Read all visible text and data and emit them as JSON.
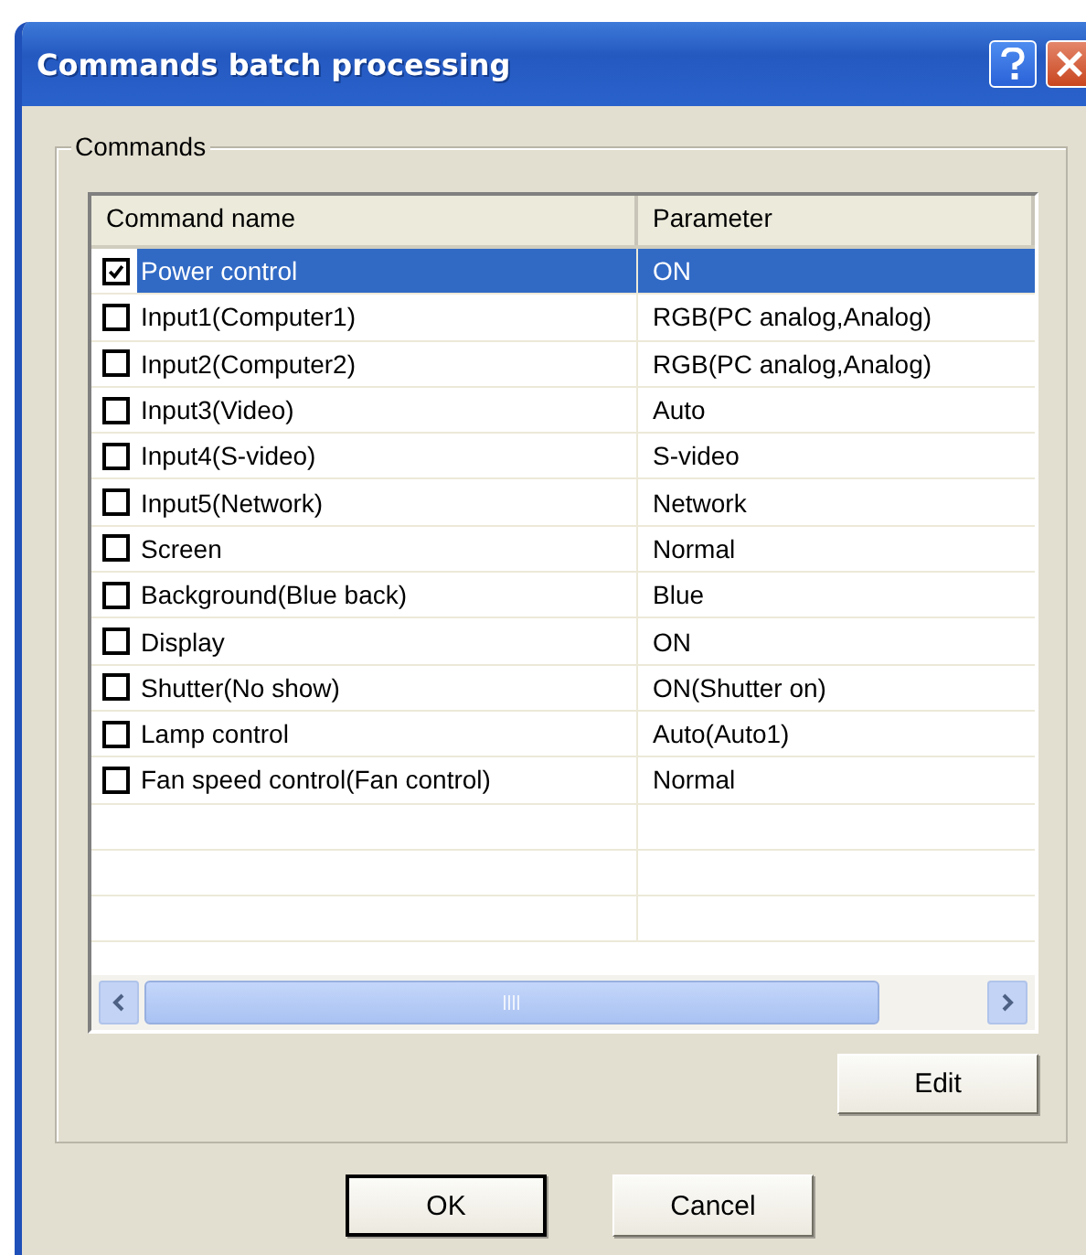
{
  "window": {
    "title": "Commands batch processing"
  },
  "group": {
    "label": "Commands"
  },
  "table": {
    "columns": [
      "Command name",
      "Parameter"
    ],
    "rows": [
      {
        "name": "Power control",
        "parameter": "ON",
        "checked": true,
        "selected": true
      },
      {
        "name": "Input1(Computer1)",
        "parameter": "RGB(PC analog,Analog)",
        "checked": false,
        "selected": false
      },
      {
        "name": "Input2(Computer2)",
        "parameter": "RGB(PC analog,Analog)",
        "checked": false,
        "selected": false
      },
      {
        "name": "Input3(Video)",
        "parameter": "Auto",
        "checked": false,
        "selected": false
      },
      {
        "name": "Input4(S-video)",
        "parameter": "S-video",
        "checked": false,
        "selected": false
      },
      {
        "name": "Input5(Network)",
        "parameter": "Network",
        "checked": false,
        "selected": false
      },
      {
        "name": "Screen",
        "parameter": "Normal",
        "checked": false,
        "selected": false
      },
      {
        "name": "Background(Blue back)",
        "parameter": "Blue",
        "checked": false,
        "selected": false
      },
      {
        "name": "Display",
        "parameter": "ON",
        "checked": false,
        "selected": false
      },
      {
        "name": "Shutter(No show)",
        "parameter": "ON(Shutter on)",
        "checked": false,
        "selected": false
      },
      {
        "name": "Lamp control",
        "parameter": "Auto(Auto1)",
        "checked": false,
        "selected": false
      },
      {
        "name": "Fan speed control(Fan control)",
        "parameter": "Normal",
        "checked": false,
        "selected": false
      }
    ]
  },
  "edit_button": "Edit",
  "buttons": [
    "OK",
    "Cancel"
  ]
}
